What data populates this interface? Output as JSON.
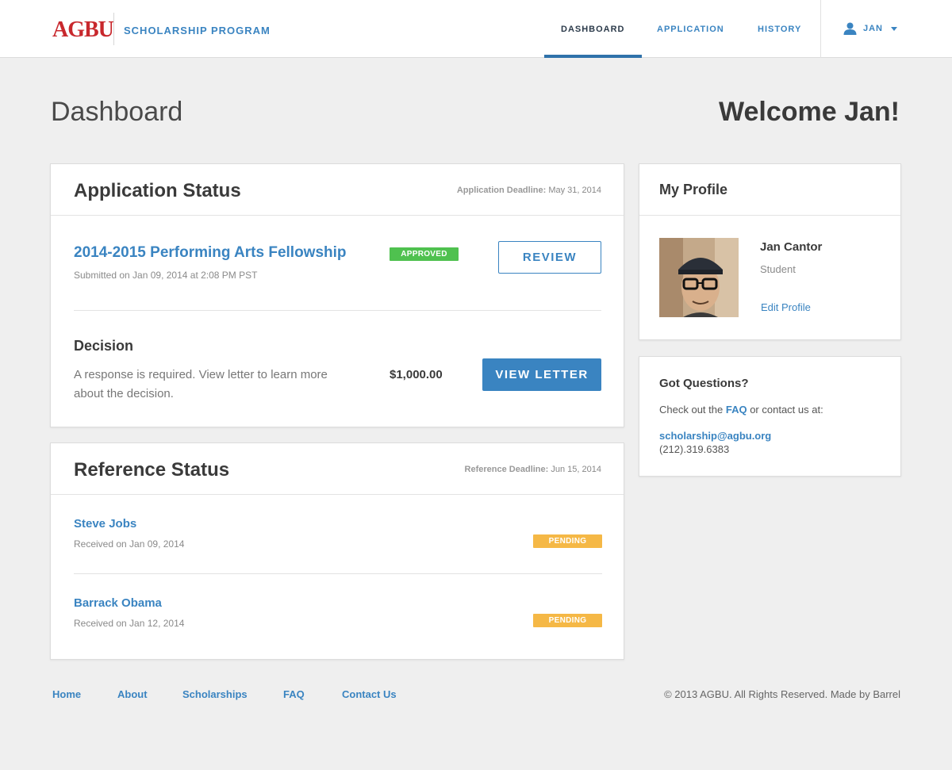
{
  "brand": {
    "logo": "AGBU",
    "program": "SCHOLARSHIP PROGRAM"
  },
  "nav": {
    "items": [
      {
        "label": "DASHBOARD",
        "active": true
      },
      {
        "label": "APPLICATION",
        "active": false
      },
      {
        "label": "HISTORY",
        "active": false
      }
    ],
    "user_label": "JAN",
    "user_icon": "user-icon",
    "caret_icon": "caret-down-icon"
  },
  "page": {
    "title": "Dashboard",
    "welcome": "Welcome Jan!"
  },
  "application_status": {
    "title": "Application Status",
    "deadline_label": "Application Deadline:",
    "deadline_value": "May 31, 2014",
    "program_name": "2014-2015 Performing Arts Fellowship",
    "submitted": "Submitted on Jan 09, 2014 at 2:08 PM PST",
    "status": "APPROVED",
    "review_label": "REVIEW",
    "decision_title": "Decision",
    "decision_text": "A response is required. View letter to learn more about the decision.",
    "amount": "$1,000.00",
    "view_letter_label": "VIEW LETTER"
  },
  "reference_status": {
    "title": "Reference Status",
    "deadline_label": "Reference Deadline:",
    "deadline_value": "Jun 15, 2014",
    "references": [
      {
        "name": "Steve Jobs",
        "received": "Received on Jan 09, 2014",
        "status": "PENDING"
      },
      {
        "name": "Barrack Obama",
        "received": "Received on Jan 12, 2014",
        "status": "PENDING"
      }
    ]
  },
  "profile": {
    "title": "My Profile",
    "name": "Jan Cantor",
    "role": "Student",
    "edit_label": "Edit Profile"
  },
  "questions": {
    "title": "Got Questions?",
    "text_before": "Check out the",
    "faq_label": "FAQ",
    "text_after": "or contact us at:",
    "email": "scholarship@agbu.org",
    "phone": "(212).319.6383"
  },
  "footer": {
    "links": [
      "Home",
      "About",
      "Scholarships",
      "FAQ",
      "Contact Us"
    ],
    "copyright": "© 2013 AGBU. All Rights Reserved. Made by Barrel"
  },
  "colors": {
    "accent": "#3a84c1",
    "approved": "#4fc14f",
    "pending": "#f5b846",
    "logo": "#c8282d"
  }
}
